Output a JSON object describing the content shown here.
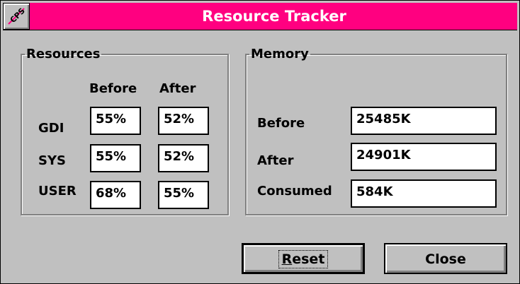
{
  "window": {
    "title": "Resource Tracker"
  },
  "resources": {
    "title": "Resources",
    "col_before": "Before",
    "col_after": "After",
    "rows": [
      {
        "label": "GDI",
        "before": "55%",
        "after": "52%"
      },
      {
        "label": "SYS",
        "before": "55%",
        "after": "52%"
      },
      {
        "label": "USER",
        "before": "68%",
        "after": "55%"
      }
    ]
  },
  "memory": {
    "title": "Memory",
    "before_label": "Before",
    "before_value": "25485K",
    "after_label": "After",
    "after_value": "24901K",
    "consumed_label": "Consumed",
    "consumed_value": "584K"
  },
  "buttons": {
    "reset_mnemonic": "R",
    "reset_rest": "eset",
    "close_label": "Close"
  },
  "icons": {
    "system_menu": "system-menu-icon"
  },
  "colors": {
    "titlebar": "#ff0080",
    "face": "#c0c0c0"
  }
}
